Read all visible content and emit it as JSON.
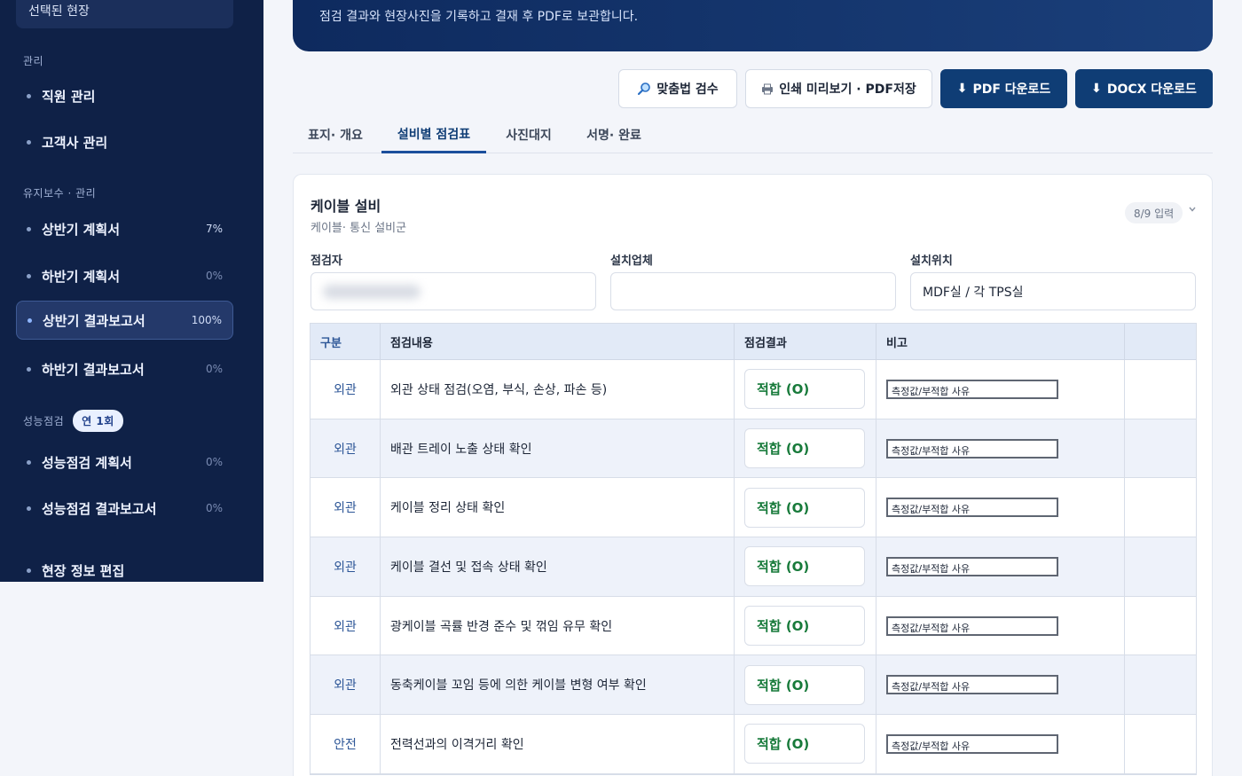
{
  "sidebar": {
    "selected_site": "선택된 현장",
    "sections": {
      "manage": "관리",
      "maintenance": "유지보수 · 관리",
      "performance": "성능점검",
      "performance_badge": "연 1회"
    },
    "items": [
      {
        "label": "직원 관리",
        "pct": ""
      },
      {
        "label": "고객사 관리",
        "pct": ""
      },
      {
        "label": "상반기 계획서",
        "pct": "7%"
      },
      {
        "label": "하반기 계획서",
        "pct": "0%"
      },
      {
        "label": "상반기 결과보고서",
        "pct": "100%"
      },
      {
        "label": "하반기 결과보고서",
        "pct": "0%"
      },
      {
        "label": "성능점검 계획서",
        "pct": "0%"
      },
      {
        "label": "성능점검 결과보고서",
        "pct": "0%"
      },
      {
        "label": "현장 정보 편집",
        "pct": ""
      }
    ]
  },
  "banner": {
    "text": "점검 결과와 현장사진을 기록하고 결재 후 PDF로 보관합니다."
  },
  "toolbar": {
    "spell_check": "맞춤법 검수",
    "print_preview": "인쇄 미리보기 · PDF저장",
    "pdf_download": "PDF 다운로드",
    "docx_download": "DOCX 다운로드"
  },
  "tabs": [
    "표지· 개요",
    "설비별 점검표",
    "사진대지",
    "서명· 완료"
  ],
  "card": {
    "title": "케이블 설비",
    "subtitle": "케이블· 통신 설비군",
    "count": "8/9 입력",
    "fields": {
      "inspector_label": "점검자",
      "installer_label": "설치업체",
      "installer_value": "",
      "location_label": "설치위치",
      "location_value": "MDF실 / 각 TPS실"
    }
  },
  "table": {
    "headers": [
      "구분",
      "점검내용",
      "점검결과",
      "비고",
      ""
    ],
    "rows": [
      {
        "category": "외관",
        "content": "외관 상태 점검(오염, 부식, 손상, 파손 등)",
        "result": "적합 (O)",
        "remark": "측정값/부적합 사유"
      },
      {
        "category": "외관",
        "content": "배관 트레이 노출 상태 확인",
        "result": "적합 (O)",
        "remark": "측정값/부적합 사유"
      },
      {
        "category": "외관",
        "content": "케이블 정리 상태 확인",
        "result": "적합 (O)",
        "remark": "측정값/부적합 사유"
      },
      {
        "category": "외관",
        "content": "케이블 결선 및 접속 상태 확인",
        "result": "적합 (O)",
        "remark": "측정값/부적합 사유"
      },
      {
        "category": "외관",
        "content": "광케이블 곡률 반경 준수 및 꺾임 유무 확인",
        "result": "적합 (O)",
        "remark": "측정값/부적합 사유"
      },
      {
        "category": "외관",
        "content": "동축케이블 꼬임 등에 의한 케이블 변형 여부 확인",
        "result": "적합 (O)",
        "remark": "측정값/부적합 사유"
      },
      {
        "category": "안전",
        "content": "전력선과의 이격거리 확인",
        "result": "적합 (O)",
        "remark": "측정값/부적합 사유"
      }
    ]
  }
}
